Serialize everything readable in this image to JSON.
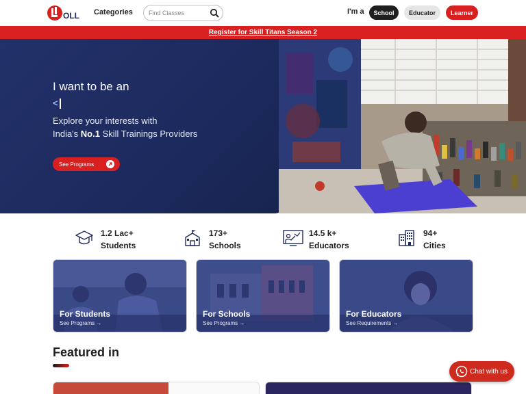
{
  "header": {
    "logo_text": "OLL",
    "categories_label": "Categories",
    "search_placeholder": "Find Classes",
    "im_a_label": "I'm a",
    "roles": [
      "School",
      "Educator",
      "Learner"
    ]
  },
  "banner": {
    "text": "Register for Skill Titans Season 2"
  },
  "hero": {
    "title": "I want to be an",
    "typed_text": "<",
    "subtitle_line1": "Explore your interests with",
    "subtitle_line2_pre": "India's ",
    "subtitle_line2_bold": "No.1",
    "subtitle_line2_post": " Skill Trainings Providers",
    "cta_label": "See Programs"
  },
  "stats": [
    {
      "value": "1.2 Lac+",
      "label": "Students",
      "icon": "graduation-cap-icon"
    },
    {
      "value": "173+",
      "label": "Schools",
      "icon": "school-building-icon"
    },
    {
      "value": "14.5 k+",
      "label": "Educators",
      "icon": "teacher-board-icon"
    },
    {
      "value": "94+",
      "label": "Cities",
      "icon": "city-buildings-icon"
    }
  ],
  "cards": [
    {
      "title": "For Students",
      "link": "See Programs →"
    },
    {
      "title": "For Schools",
      "link": "See Programs →"
    },
    {
      "title": "For Educators",
      "link": "See Requirements →"
    }
  ],
  "featured": {
    "heading": "Featured in"
  },
  "chat": {
    "label": "Chat with us"
  },
  "colors": {
    "brand_red": "#d7201f",
    "navy": "#23316a"
  }
}
